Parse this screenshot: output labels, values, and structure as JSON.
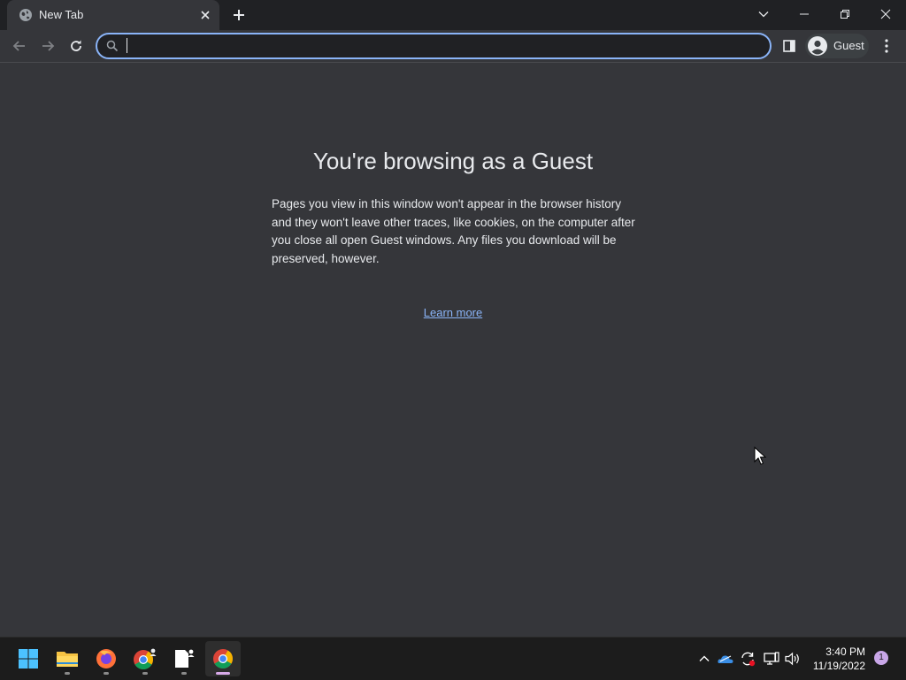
{
  "window": {
    "tab": {
      "title": "New Tab"
    }
  },
  "toolbar": {
    "address_value": "",
    "profile_label": "Guest"
  },
  "page": {
    "heading": "You're browsing as a Guest",
    "paragraph": "Pages you view in this window won't appear in the browser history and they won't leave other traces, like cookies, on the computer after you close all open Guest windows. Any files you download will be preserved, however.",
    "learn_more": "Learn more"
  },
  "taskbar": {
    "apps": [
      "start",
      "file-explorer",
      "firefox",
      "chrome-guest",
      "notepad",
      "chrome"
    ],
    "time": "3:40 PM",
    "date": "11/19/2022",
    "notification_count": "1"
  },
  "colors": {
    "accent": "#8ab4f8",
    "page_background": "#35363a",
    "titlebar": "#202124",
    "taskbar": "#1c1c1c"
  }
}
